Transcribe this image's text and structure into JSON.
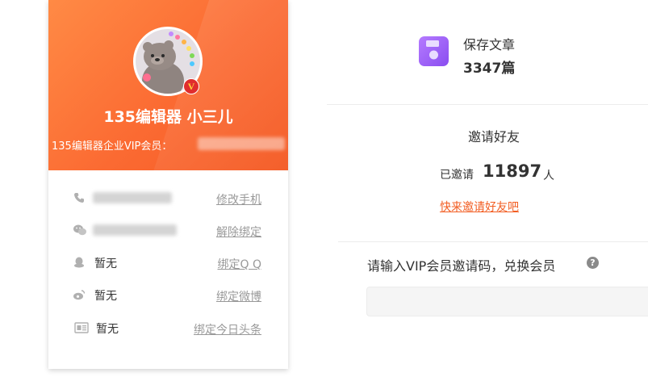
{
  "profile": {
    "nickname": "135编辑器 小三儿",
    "vip_label": "135编辑器企业VIP会员：",
    "vip_badge": "V"
  },
  "bindings": [
    {
      "icon": "phone-icon",
      "value": "",
      "action": "修改手机"
    },
    {
      "icon": "wechat-icon",
      "value": "",
      "action": "解除绑定"
    },
    {
      "icon": "qq-icon",
      "value": "暂无",
      "action": "绑定Q Q"
    },
    {
      "icon": "weibo-icon",
      "value": "暂无",
      "action": "绑定微博"
    },
    {
      "icon": "toutiao-icon",
      "value": "暂无",
      "action": "绑定今日头条"
    }
  ],
  "saved": {
    "icon": "save-icon",
    "label": "保存文章",
    "count": "3347篇"
  },
  "invite": {
    "title": "邀请好友",
    "prefix": "已邀请",
    "count": "11897",
    "unit": "人",
    "link": "快来邀请好友吧"
  },
  "redeem": {
    "label": "请输入VIP会员邀请码，兑换会员",
    "help": "?",
    "placeholder": "",
    "value": ""
  },
  "colors": {
    "header_gradient_start": "#ff8a45",
    "header_gradient_end": "#f45a24",
    "link_orange": "#f25d22",
    "save_icon_purple": "#9b5cf6"
  }
}
